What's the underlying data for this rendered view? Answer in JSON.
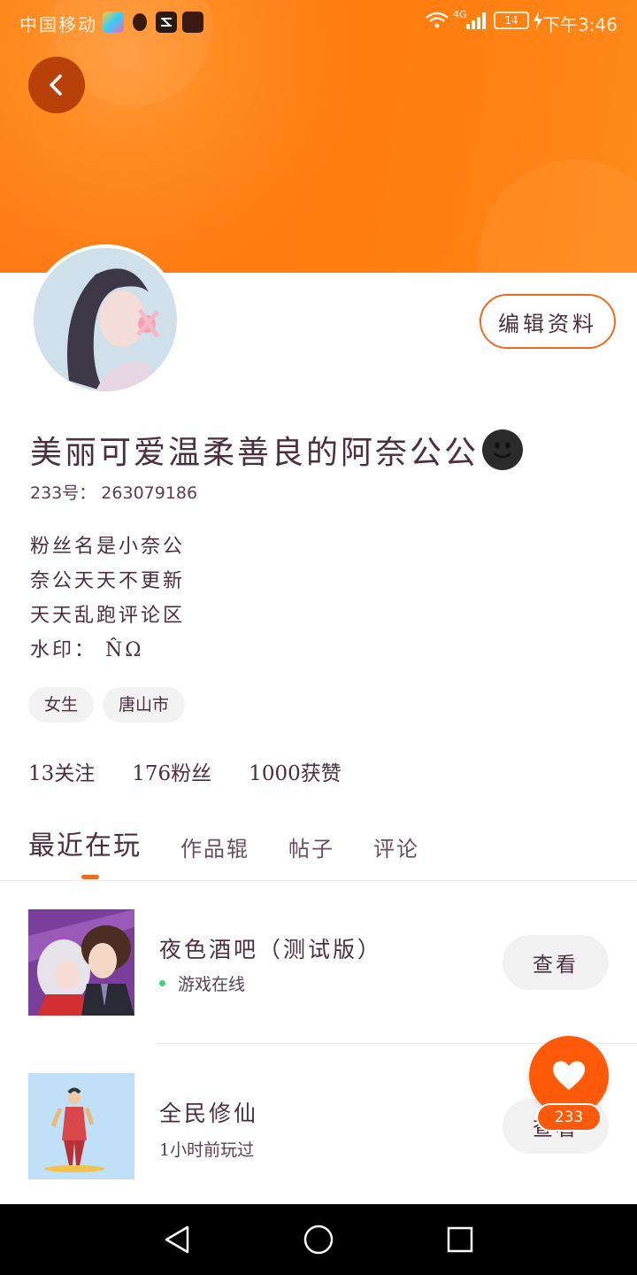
{
  "status_bar": {
    "carrier": "中国移动",
    "network": "4G",
    "battery": "14",
    "time": "下午3:46"
  },
  "header": {
    "back_icon": "chevron-left-icon"
  },
  "profile": {
    "edit_button": "编辑资料",
    "nickname": "美丽可爱温柔善良的阿奈公公",
    "id_line": "233号： 263079186",
    "bio": [
      "粉丝名是小奈公",
      "奈公天天不更新",
      "天天乱跑评论区",
      "水印： N̂Ω"
    ],
    "tags": [
      "女生",
      "唐山市"
    ],
    "stats": [
      "13关注",
      "176粉丝",
      "1000获赞"
    ]
  },
  "tabs": [
    "最近在玩",
    "作品辊",
    "帖子",
    "评论"
  ],
  "games": [
    {
      "title": "夜色酒吧（测试版）",
      "status": "游戏在线",
      "button": "查看"
    },
    {
      "title": "全民修仙",
      "status": "1小时前玩过",
      "button": "查看"
    }
  ],
  "fab": {
    "icon": "heart-icon",
    "badge": "233"
  },
  "colors": {
    "accent": "#ff6a10",
    "online": "#3fcf7a"
  }
}
